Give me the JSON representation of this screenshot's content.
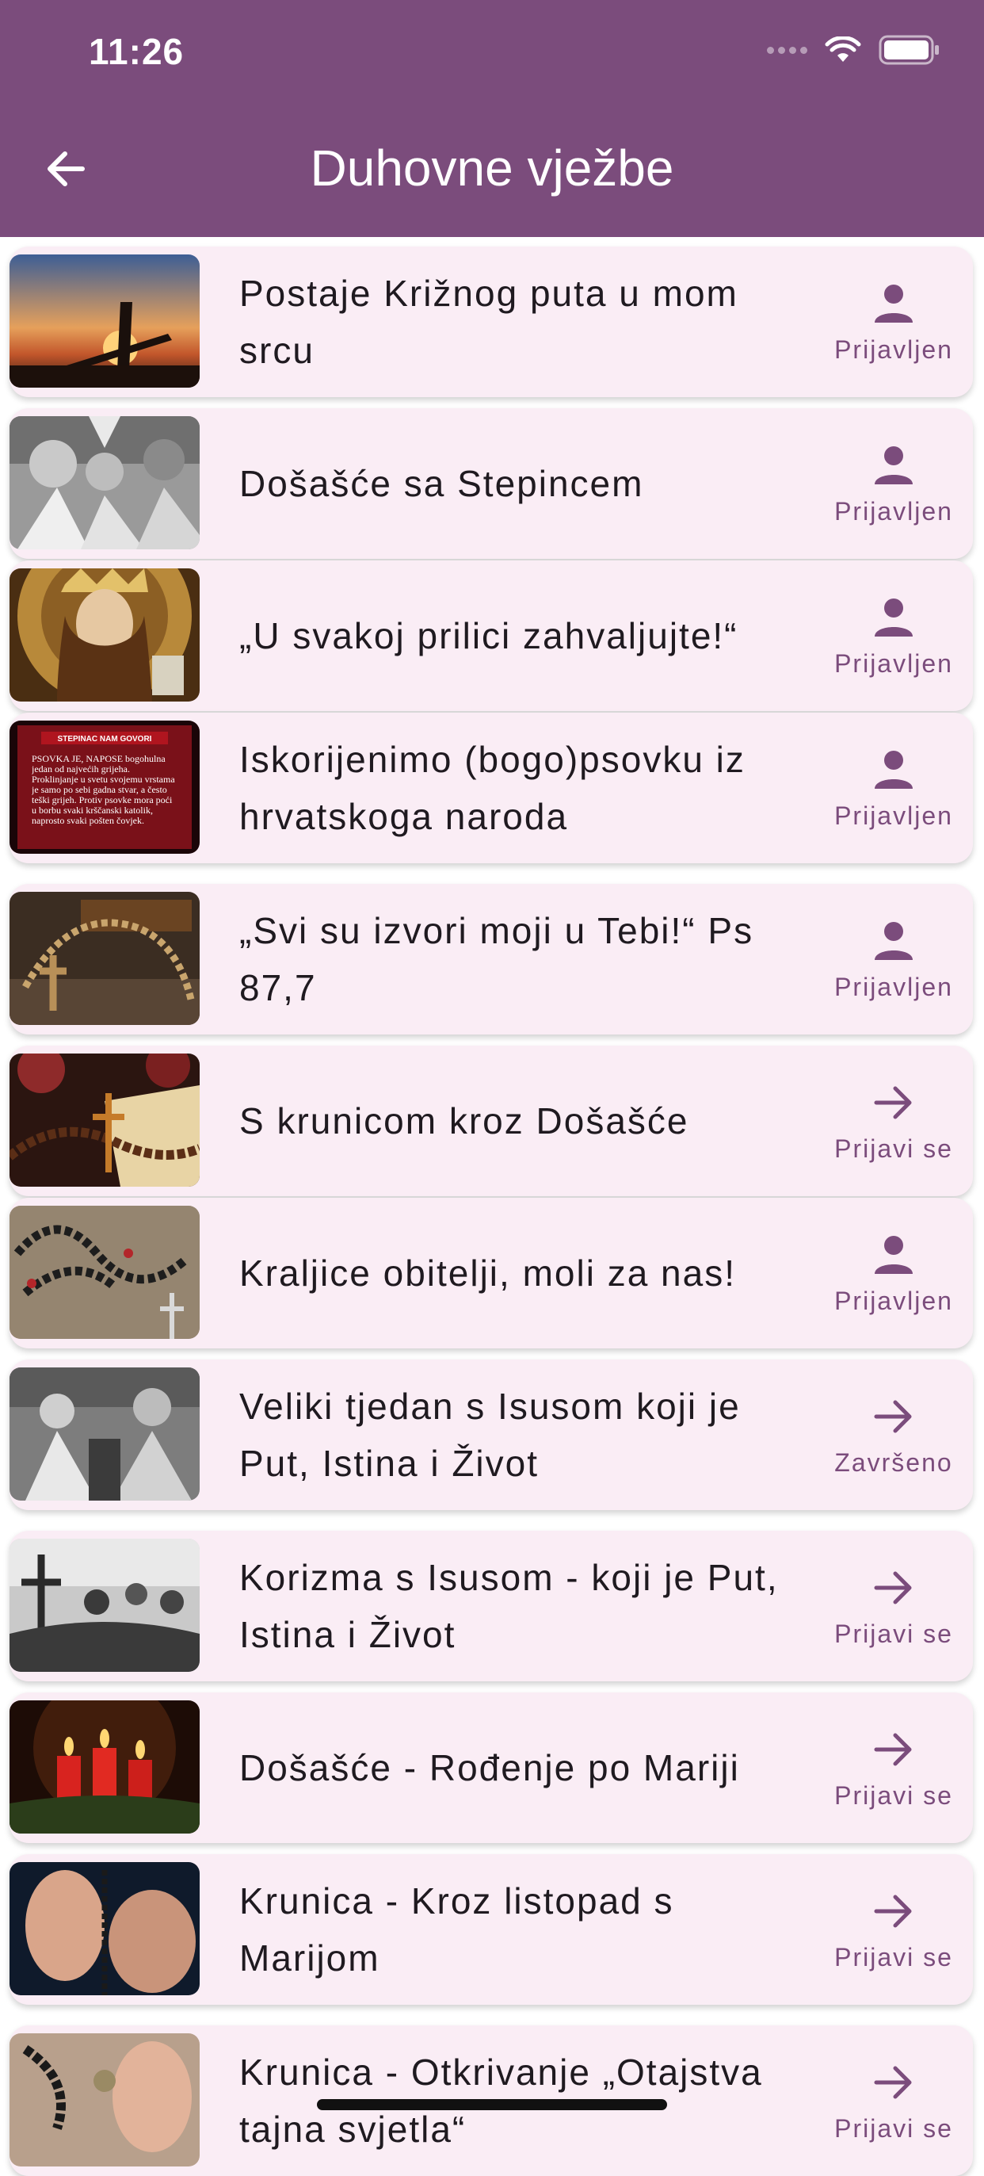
{
  "status_bar": {
    "time": "11:26"
  },
  "header": {
    "title": "Duhovne vježbe"
  },
  "colors": {
    "header": "#7b4c7c",
    "card": "#faedf5",
    "accent": "#7b4c7c"
  },
  "items": [
    {
      "title": "Postaje Križnog puta u mom srcu",
      "action": "Prijavljen",
      "icon": "person-icon"
    },
    {
      "title": "Došašće sa Stepincem",
      "action": "Prijavljen",
      "icon": "person-icon"
    },
    {
      "title": "„U svakoj prilici zahvaljujte!“",
      "action": "Prijavljen",
      "icon": "person-icon"
    },
    {
      "title": "Iskorijenimo (bogo)psovku iz hrvatskoga naroda",
      "action": "Prijavljen",
      "icon": "person-icon",
      "thumb_text": {
        "heading": "STEPINAC NAM GOVORI",
        "body": "PSOVKA JE, NAPOSE bogohulna jedan od najvećih grijeha. Proklinjanje u svetu svojemu vrstama je samo po sebi gadna stvar, a često teški grijeh. Protiv psovke mora poći u borbu svaki krščanski katolik, naprosto svaki pošten čovjek."
      }
    },
    {
      "title": "„Svi su izvori moji u Tebi!“ Ps 87,7",
      "action": "Prijavljen",
      "icon": "person-icon"
    },
    {
      "title": "S krunicom kroz Došašće",
      "action": "Prijavi se",
      "icon": "arrow-right-icon"
    },
    {
      "title": "Kraljice obitelji, moli za nas!",
      "action": "Prijavljen",
      "icon": "person-icon"
    },
    {
      "title": "Veliki tjedan s Isusom koji je Put, Istina i Život",
      "action": "Završeno",
      "icon": "arrow-right-icon"
    },
    {
      "title": "Korizma s Isusom - koji je Put, Istina i Život",
      "action": "Prijavi se",
      "icon": "arrow-right-icon"
    },
    {
      "title": "Došašće - Rođenje po Mariji",
      "action": "Prijavi se",
      "icon": "arrow-right-icon"
    },
    {
      "title": "Krunica - Kroz listopad s Marijom",
      "action": "Prijavi se",
      "icon": "arrow-right-icon"
    },
    {
      "title": "Krunica - Otkrivanje „Otajstva tajna svjetla“",
      "action": "Prijavi se",
      "icon": "arrow-right-icon"
    }
  ]
}
